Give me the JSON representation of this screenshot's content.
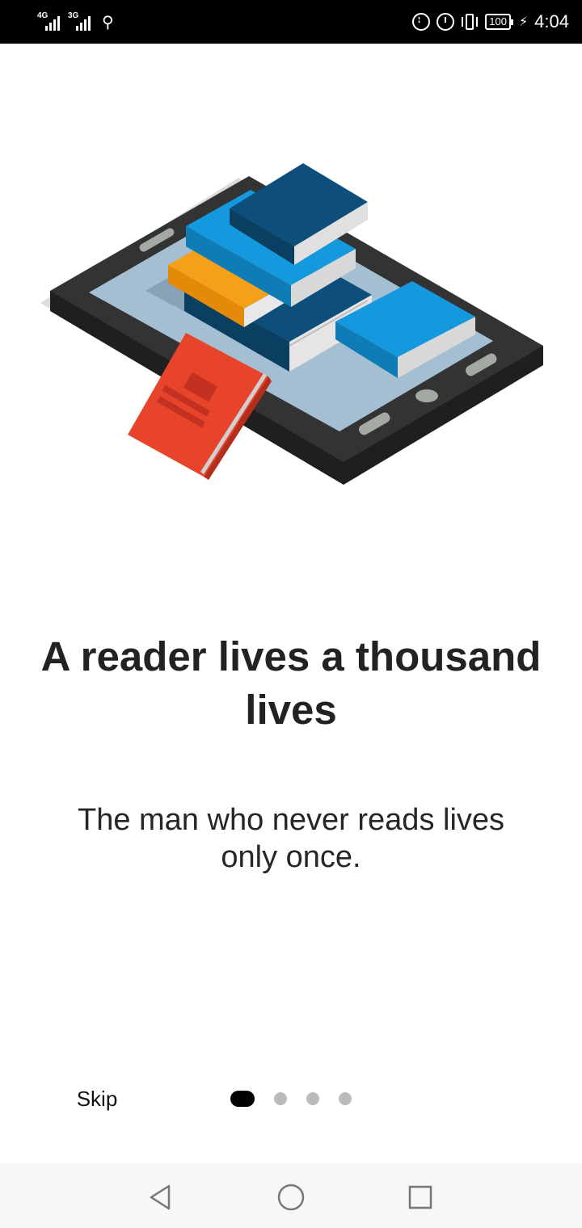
{
  "status_bar": {
    "signal1_label": "4G",
    "signal2_label": "3G",
    "usb_icon": "usb-icon",
    "battery_level": "100",
    "time": "4:04"
  },
  "onboarding": {
    "illustration": "tablet-with-books-illustration",
    "title": "A reader lives a thousand lives",
    "subtitle": "The man who never reads lives only once.",
    "skip_label": "Skip",
    "page_indicator": {
      "total": 4,
      "current": 1
    }
  },
  "navigation_bar": {
    "back_icon": "back-triangle-icon",
    "home_icon": "home-circle-icon",
    "recents_icon": "recents-square-icon"
  },
  "colors": {
    "accent_red": "#E8432B",
    "book_navy": "#0D4F7A",
    "book_blue": "#1499DE",
    "book_orange": "#F28A0C",
    "tablet_dark": "#2E2E2E",
    "dot_active": "#000000",
    "dot_inactive": "#BBBBBB"
  }
}
